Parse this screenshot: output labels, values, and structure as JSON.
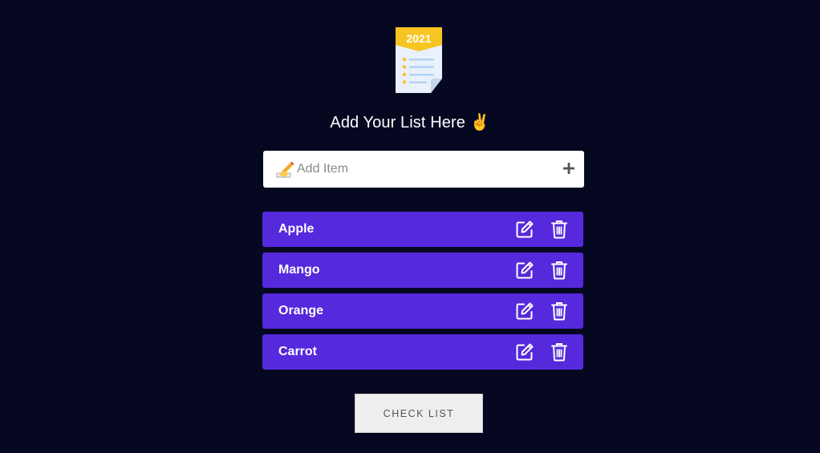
{
  "logo": {
    "year": "2021",
    "icon": "checklist-document-icon"
  },
  "header": {
    "title": "Add Your List Here ✌️"
  },
  "add_input": {
    "placeholder": "Add Item",
    "value": "",
    "icon": "writing-hand-icon",
    "add_icon": "plus-icon"
  },
  "items": [
    {
      "label": "Apple"
    },
    {
      "label": "Mango"
    },
    {
      "label": "Orange"
    },
    {
      "label": "Carrot"
    }
  ],
  "item_actions": {
    "edit_icon": "edit-icon",
    "delete_icon": "trash-icon"
  },
  "check_button": {
    "label": "CHECK LIST"
  },
  "colors": {
    "background": "#060822",
    "item_background": "#5529dc",
    "logo_yellow": "#f7c422",
    "logo_paper": "#e8f1fc",
    "logo_lines": "#b3d0f2"
  }
}
